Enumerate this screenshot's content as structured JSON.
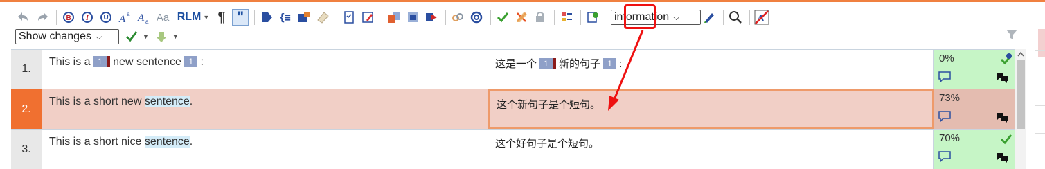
{
  "toolbar": {
    "rlm_label": "RLM",
    "pilcrow": "¶",
    "quote_glyph": "\"",
    "aa_label": "Aa",
    "category_select": "information",
    "show_changes_select": "Show changes"
  },
  "grid": {
    "rows": [
      {
        "number": "1.",
        "source": {
          "before": "This is a ",
          "tag1": "1",
          "middle": "new sentence",
          "tag2": "1",
          "after": ":"
        },
        "target": {
          "before": "这是一个 ",
          "tag1": "1",
          "middle": "新的句子",
          "tag2": "1",
          "after": ":"
        },
        "match": "0%"
      },
      {
        "number": "2.",
        "source": {
          "text": "This is a short new ",
          "highlight": "sentence",
          "end": "."
        },
        "target": {
          "text": "这个新句子是个短句。"
        },
        "match": "73%"
      },
      {
        "number": "3.",
        "source": {
          "text": "This is a short nice ",
          "highlight": "sentence",
          "end": "."
        },
        "target": {
          "text": "这个好句子是个短句。"
        },
        "match": "70%"
      }
    ]
  },
  "colors": {
    "accent_orange": "#f07030",
    "annotation_red": "#ee1111",
    "match_green": "#c6f5c6",
    "active_row": "#f1cfc6"
  }
}
